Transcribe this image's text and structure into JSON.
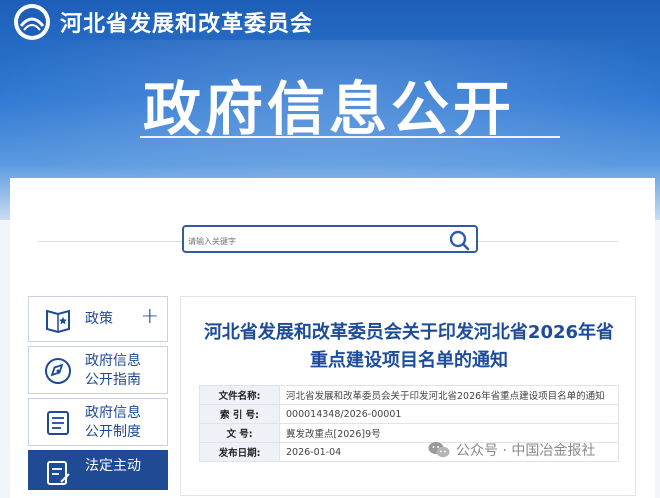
{
  "header": {
    "org_name": "河北省发展和改革委员会",
    "banner_title": "政府信息公开"
  },
  "search": {
    "placeholder": "请输入关键字"
  },
  "sidebar": {
    "items": [
      {
        "lines": [
          "政策"
        ],
        "icon": "book-star-icon",
        "has_plus": true
      },
      {
        "lines": [
          "政府信息",
          "公开指南"
        ],
        "icon": "compass-icon"
      },
      {
        "lines": [
          "政府信息",
          "公开制度"
        ],
        "icon": "document-list-icon"
      },
      {
        "lines": [
          "法定主动"
        ],
        "icon": "edit-document-icon",
        "active": true
      }
    ],
    "plus_symbol": "+"
  },
  "article": {
    "title_lines": [
      "河北省发展和改革委员会关于印发河北省2026年省",
      "重点建设项目名单的通知"
    ],
    "meta": [
      {
        "label": "文件名称:",
        "value": "河北省发展和改革委员会关于印发河北省2026年省重点建设项目名单的通知"
      },
      {
        "label": "索 引 号:",
        "value": "000014348/2026-00001"
      },
      {
        "label": "文    号:",
        "value": "冀发改重点[2026]9号"
      },
      {
        "label": "发布日期:",
        "value": "2026-01-04"
      }
    ]
  },
  "watermark": {
    "text": "公众号 · 中国冶金报社"
  },
  "colors": {
    "primary": "#1f4b94",
    "banner": "#2f78d3",
    "title": "#1c4c9a"
  }
}
